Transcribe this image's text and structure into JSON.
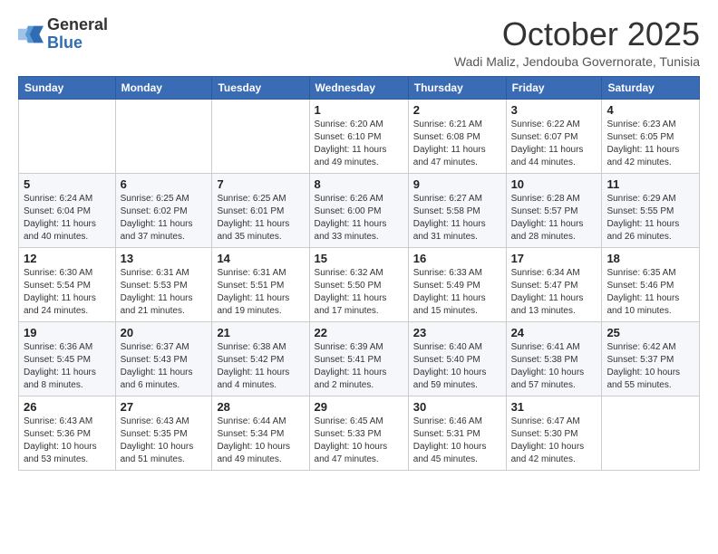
{
  "header": {
    "logo_general": "General",
    "logo_blue": "Blue",
    "title": "October 2025",
    "subtitle": "Wadi Maliz, Jendouba Governorate, Tunisia"
  },
  "weekdays": [
    "Sunday",
    "Monday",
    "Tuesday",
    "Wednesday",
    "Thursday",
    "Friday",
    "Saturday"
  ],
  "weeks": [
    [
      {
        "day": "",
        "info": ""
      },
      {
        "day": "",
        "info": ""
      },
      {
        "day": "",
        "info": ""
      },
      {
        "day": "1",
        "info": "Sunrise: 6:20 AM\nSunset: 6:10 PM\nDaylight: 11 hours and 49 minutes."
      },
      {
        "day": "2",
        "info": "Sunrise: 6:21 AM\nSunset: 6:08 PM\nDaylight: 11 hours and 47 minutes."
      },
      {
        "day": "3",
        "info": "Sunrise: 6:22 AM\nSunset: 6:07 PM\nDaylight: 11 hours and 44 minutes."
      },
      {
        "day": "4",
        "info": "Sunrise: 6:23 AM\nSunset: 6:05 PM\nDaylight: 11 hours and 42 minutes."
      }
    ],
    [
      {
        "day": "5",
        "info": "Sunrise: 6:24 AM\nSunset: 6:04 PM\nDaylight: 11 hours and 40 minutes."
      },
      {
        "day": "6",
        "info": "Sunrise: 6:25 AM\nSunset: 6:02 PM\nDaylight: 11 hours and 37 minutes."
      },
      {
        "day": "7",
        "info": "Sunrise: 6:25 AM\nSunset: 6:01 PM\nDaylight: 11 hours and 35 minutes."
      },
      {
        "day": "8",
        "info": "Sunrise: 6:26 AM\nSunset: 6:00 PM\nDaylight: 11 hours and 33 minutes."
      },
      {
        "day": "9",
        "info": "Sunrise: 6:27 AM\nSunset: 5:58 PM\nDaylight: 11 hours and 31 minutes."
      },
      {
        "day": "10",
        "info": "Sunrise: 6:28 AM\nSunset: 5:57 PM\nDaylight: 11 hours and 28 minutes."
      },
      {
        "day": "11",
        "info": "Sunrise: 6:29 AM\nSunset: 5:55 PM\nDaylight: 11 hours and 26 minutes."
      }
    ],
    [
      {
        "day": "12",
        "info": "Sunrise: 6:30 AM\nSunset: 5:54 PM\nDaylight: 11 hours and 24 minutes."
      },
      {
        "day": "13",
        "info": "Sunrise: 6:31 AM\nSunset: 5:53 PM\nDaylight: 11 hours and 21 minutes."
      },
      {
        "day": "14",
        "info": "Sunrise: 6:31 AM\nSunset: 5:51 PM\nDaylight: 11 hours and 19 minutes."
      },
      {
        "day": "15",
        "info": "Sunrise: 6:32 AM\nSunset: 5:50 PM\nDaylight: 11 hours and 17 minutes."
      },
      {
        "day": "16",
        "info": "Sunrise: 6:33 AM\nSunset: 5:49 PM\nDaylight: 11 hours and 15 minutes."
      },
      {
        "day": "17",
        "info": "Sunrise: 6:34 AM\nSunset: 5:47 PM\nDaylight: 11 hours and 13 minutes."
      },
      {
        "day": "18",
        "info": "Sunrise: 6:35 AM\nSunset: 5:46 PM\nDaylight: 11 hours and 10 minutes."
      }
    ],
    [
      {
        "day": "19",
        "info": "Sunrise: 6:36 AM\nSunset: 5:45 PM\nDaylight: 11 hours and 8 minutes."
      },
      {
        "day": "20",
        "info": "Sunrise: 6:37 AM\nSunset: 5:43 PM\nDaylight: 11 hours and 6 minutes."
      },
      {
        "day": "21",
        "info": "Sunrise: 6:38 AM\nSunset: 5:42 PM\nDaylight: 11 hours and 4 minutes."
      },
      {
        "day": "22",
        "info": "Sunrise: 6:39 AM\nSunset: 5:41 PM\nDaylight: 11 hours and 2 minutes."
      },
      {
        "day": "23",
        "info": "Sunrise: 6:40 AM\nSunset: 5:40 PM\nDaylight: 10 hours and 59 minutes."
      },
      {
        "day": "24",
        "info": "Sunrise: 6:41 AM\nSunset: 5:38 PM\nDaylight: 10 hours and 57 minutes."
      },
      {
        "day": "25",
        "info": "Sunrise: 6:42 AM\nSunset: 5:37 PM\nDaylight: 10 hours and 55 minutes."
      }
    ],
    [
      {
        "day": "26",
        "info": "Sunrise: 6:43 AM\nSunset: 5:36 PM\nDaylight: 10 hours and 53 minutes."
      },
      {
        "day": "27",
        "info": "Sunrise: 6:43 AM\nSunset: 5:35 PM\nDaylight: 10 hours and 51 minutes."
      },
      {
        "day": "28",
        "info": "Sunrise: 6:44 AM\nSunset: 5:34 PM\nDaylight: 10 hours and 49 minutes."
      },
      {
        "day": "29",
        "info": "Sunrise: 6:45 AM\nSunset: 5:33 PM\nDaylight: 10 hours and 47 minutes."
      },
      {
        "day": "30",
        "info": "Sunrise: 6:46 AM\nSunset: 5:31 PM\nDaylight: 10 hours and 45 minutes."
      },
      {
        "day": "31",
        "info": "Sunrise: 6:47 AM\nSunset: 5:30 PM\nDaylight: 10 hours and 42 minutes."
      },
      {
        "day": "",
        "info": ""
      }
    ]
  ]
}
